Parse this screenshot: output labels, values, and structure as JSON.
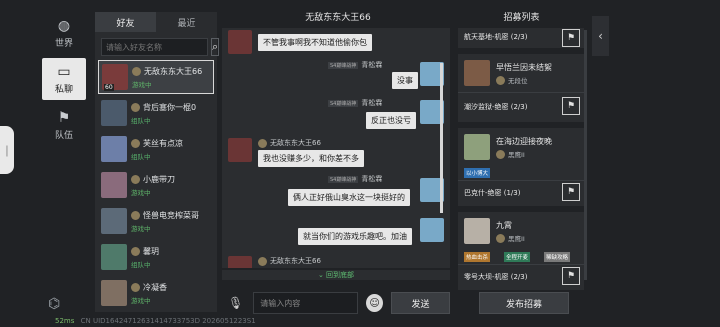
{
  "rail": {
    "items": [
      {
        "label": "世界",
        "icon": "globe-icon",
        "glyph": "◍"
      },
      {
        "label": "私聊",
        "icon": "chat-bubble-icon",
        "glyph": "▭"
      },
      {
        "label": "队伍",
        "icon": "flag-icon",
        "glyph": "⚑"
      }
    ],
    "bottom_icon": "controller-icon",
    "bottom_glyph": "⌬"
  },
  "status": {
    "ping": "52ms",
    "uid": "CN UID16424712631414733753D 2026051223S1"
  },
  "friends": {
    "tabs": [
      "好友",
      "最近"
    ],
    "search_placeholder": "请输入好友名称",
    "items": [
      {
        "name": "无敌东东大王66",
        "state": "游戏中",
        "level": "60",
        "color": "#7a3b3b"
      },
      {
        "name": "背后塞你一棍0",
        "state": "组队中",
        "level": "",
        "color": "#4b5a6b"
      },
      {
        "name": "芙丝有点凉",
        "state": "组队中",
        "level": "",
        "color": "#6d7fa8"
      },
      {
        "name": "小鹿带刀",
        "state": "游戏中",
        "level": "",
        "color": "#8a6b7c"
      },
      {
        "name": "怪兽电竞榨菜哥",
        "state": "游戏中",
        "level": "",
        "color": "#5c6a78"
      },
      {
        "name": "馨玥",
        "state": "组队中",
        "level": "",
        "color": "#4f7a6a"
      },
      {
        "name": "冷凝香",
        "state": "游戏中",
        "level": "",
        "color": "#7f6f62"
      }
    ]
  },
  "chat": {
    "title": "无敌东东大王66",
    "messages": [
      {
        "side": "left",
        "name": "",
        "text": "不管我事啊我不知道他偷你包"
      },
      {
        "side": "right",
        "name": "青松霖",
        "tag": "S4巅峰战神",
        "text": "没事"
      },
      {
        "side": "right",
        "name": "青松霖",
        "tag": "S4巅峰战神",
        "text": "反正也没亏"
      },
      {
        "side": "left",
        "name": "无敌东东大王66",
        "text": "我也没赚多少，和你差不多"
      },
      {
        "side": "right",
        "name": "青松霖",
        "tag": "S4巅峰战神",
        "text": "俩人正好俄山臭水这一块挺好的"
      },
      {
        "side": "right",
        "name": "",
        "text": "就当你们的游戏乐趣吧。加油"
      },
      {
        "side": "left",
        "name": "无敌东东大王66",
        "text": ""
      }
    ],
    "back_to_bottom": "回到底部",
    "input_placeholder": "请输入内容",
    "send_label": "发送"
  },
  "recruit": {
    "title": "招募列表",
    "cards": [
      {
        "mode": "航天基地-机密 (2/3)"
      },
      {
        "name": "早悟兰因未结絮",
        "rank": "无段位",
        "mode": "潮汐监狱-绝密 (2/3)"
      },
      {
        "name": "在海边迎接夜晚",
        "rank": "黑鹰II",
        "chip": "以小博大",
        "mode": "巴克什-绝密 (1/3)"
      },
      {
        "name": "九霄",
        "rank": "黑鹰II",
        "chips": [
          "热血击杀",
          "全程开麦",
          "稀缺攻略"
        ],
        "mode": "零号大坝-机密 (2/3)"
      }
    ],
    "publish_label": "发布招募"
  }
}
